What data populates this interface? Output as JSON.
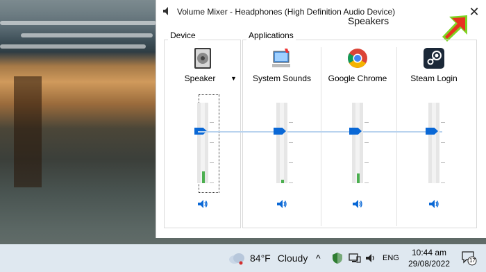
{
  "window": {
    "title": "Volume Mixer - Headphones (High Definition Audio Device)",
    "tooltip": "Speakers",
    "close_glyph": "✕"
  },
  "groups": {
    "device_label": "Device",
    "applications_label": "Applications"
  },
  "channels": [
    {
      "label": "Speaker",
      "icon": "speaker-device-icon",
      "level": 0.15,
      "volume": 0.65,
      "has_dropdown": true
    },
    {
      "label": "System Sounds",
      "icon": "system-sounds-icon",
      "level": 0.04,
      "volume": 0.65
    },
    {
      "label": "Google Chrome",
      "icon": "chrome-icon",
      "level": 0.12,
      "volume": 0.65
    },
    {
      "label": "Steam Login",
      "icon": "steam-icon",
      "level": 0.0,
      "volume": 0.65
    }
  ],
  "taskbar": {
    "weather_temp": "84°F",
    "weather_condition": "Cloudy",
    "language": "ENG",
    "time": "10:44 am",
    "date": "29/08/2022",
    "notification_count": "17"
  },
  "colors": {
    "accent": "#0a68d6",
    "arrow": "#e8321f",
    "arrow_outline": "#7ed321",
    "level": "#4caf50"
  }
}
